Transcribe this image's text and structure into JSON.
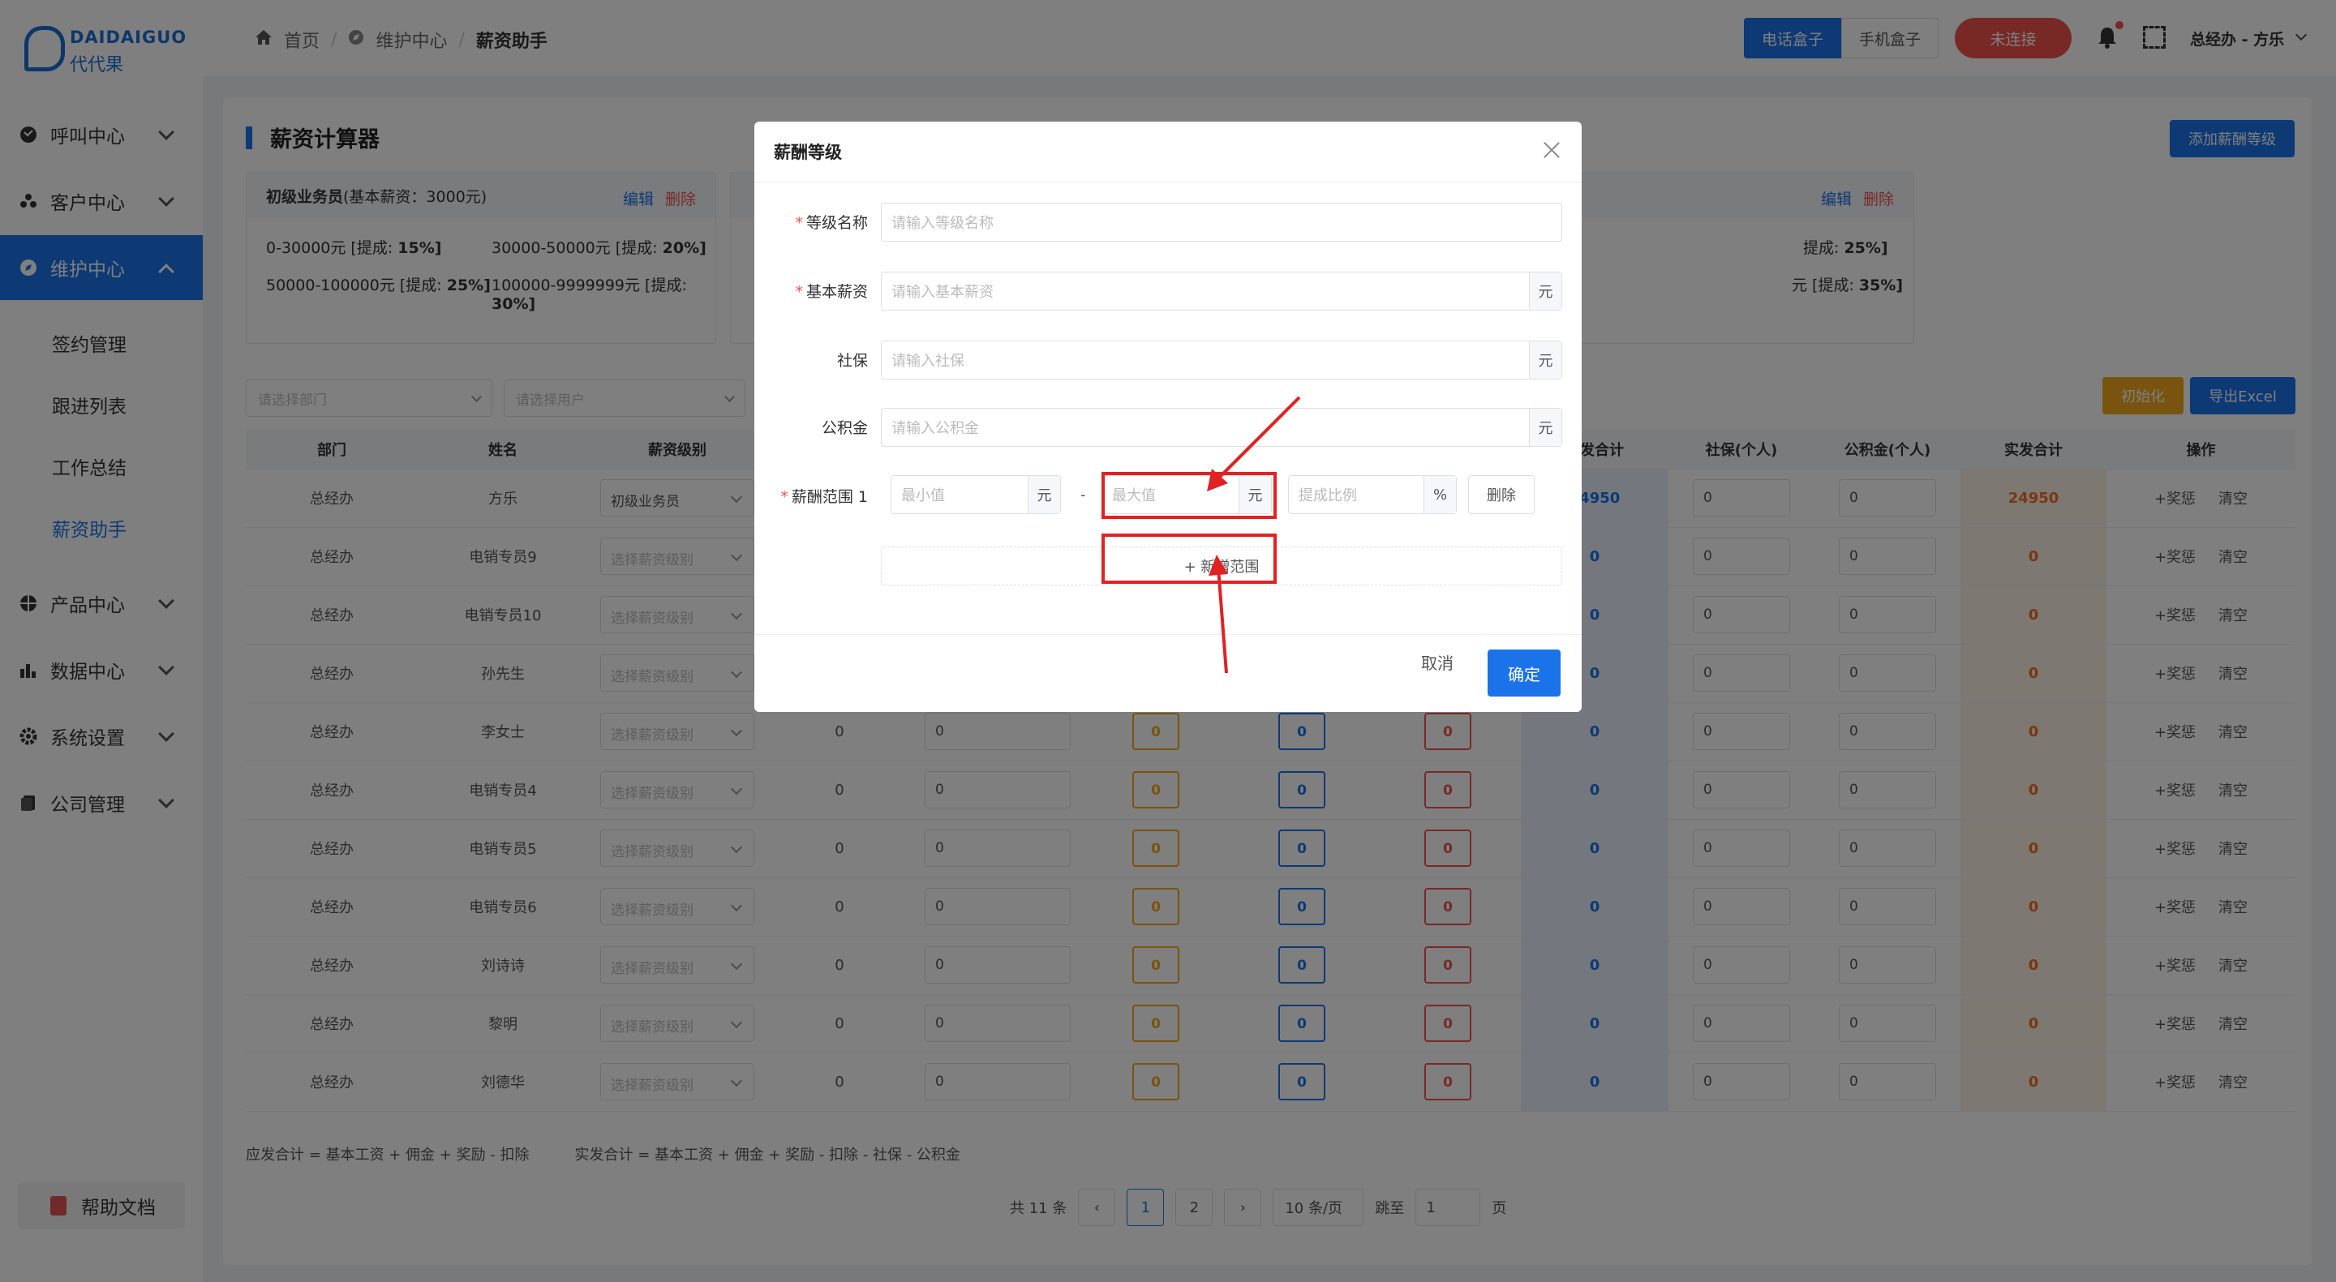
{
  "brand": {
    "name_en": "DAIDAIGUO",
    "name_cn": "代代果"
  },
  "sidebar": {
    "items": [
      {
        "label": "呼叫中心",
        "icon": "phone-icon"
      },
      {
        "label": "客户中心",
        "icon": "users-icon"
      },
      {
        "label": "维护中心",
        "icon": "compass-icon"
      },
      {
        "label": "产品中心",
        "icon": "box-icon"
      },
      {
        "label": "数据中心",
        "icon": "bar-chart-icon"
      },
      {
        "label": "系统设置",
        "icon": "gear-icon"
      },
      {
        "label": "公司管理",
        "icon": "file-icon"
      }
    ],
    "subitems": [
      "签约管理",
      "跟进列表",
      "工作总结",
      "薪资助手"
    ],
    "help": "帮助文档"
  },
  "header": {
    "breadcrumb": [
      "首页",
      "维护中心",
      "薪资助手"
    ],
    "phone_box": "电话盒子",
    "mobile_box": "手机盒子",
    "connection": "未连接",
    "user": "总经办 - 方乐"
  },
  "page": {
    "title": "薪资计算器",
    "add_level": "添加薪酬等级",
    "init": "初始化",
    "export": "导出Excel",
    "level_card": {
      "name": "初级业务员",
      "base": "(基本薪资：3000元)",
      "edit": "编辑",
      "delete": "删除",
      "ranges": [
        {
          "text": "0-30000元 [提成: ",
          "rate": "15%]"
        },
        {
          "text": "30000-50000元 [提成: ",
          "rate": "20%]"
        },
        {
          "text": "50000-100000元 [提成: ",
          "rate": "25%]"
        },
        {
          "text": "100000-9999999元 [提成: ",
          "rate": "30%]"
        }
      ]
    },
    "level_card2": {
      "edit": "编辑",
      "delete": "删除",
      "ranges": [
        {
          "text": "提成: ",
          "rate": "25%]"
        },
        {
          "text": "元 [提成: ",
          "rate": "35%]"
        }
      ]
    },
    "filters": {
      "dept": "请选择部门",
      "user": "请选择用户"
    },
    "columns": [
      "部门",
      "姓名",
      "薪资级别",
      "",
      "",
      "",
      "",
      "",
      "应发合计",
      "社保(个人)",
      "公积金(个人)",
      "实发合计",
      "操作"
    ],
    "rows": [
      {
        "dept": "总经办",
        "name": "方乐",
        "level": "初级业务员",
        "filled": true,
        "base": "",
        "sales": "",
        "due": "24950",
        "social": "0",
        "fund": "0",
        "net": "24950"
      },
      {
        "dept": "总经办",
        "name": "电销专员9",
        "level": "选择薪资级别",
        "filled": false,
        "base": "",
        "sales": "",
        "due": "0",
        "social": "0",
        "fund": "0",
        "net": "0"
      },
      {
        "dept": "总经办",
        "name": "电销专员10",
        "level": "选择薪资级别",
        "filled": false,
        "base": "",
        "sales": "",
        "due": "0",
        "social": "0",
        "fund": "0",
        "net": "0"
      },
      {
        "dept": "总经办",
        "name": "孙先生",
        "level": "选择薪资级别",
        "filled": false,
        "base": "",
        "sales": "",
        "due": "0",
        "social": "0",
        "fund": "0",
        "net": "0"
      },
      {
        "dept": "总经办",
        "name": "李女士",
        "level": "选择薪资级别",
        "filled": false,
        "base": "0",
        "sales": "0",
        "due": "0",
        "social": "0",
        "fund": "0",
        "net": "0"
      },
      {
        "dept": "总经办",
        "name": "电销专员4",
        "level": "选择薪资级别",
        "filled": false,
        "base": "0",
        "sales": "0",
        "due": "0",
        "social": "0",
        "fund": "0",
        "net": "0"
      },
      {
        "dept": "总经办",
        "name": "电销专员5",
        "level": "选择薪资级别",
        "filled": false,
        "base": "0",
        "sales": "0",
        "due": "0",
        "social": "0",
        "fund": "0",
        "net": "0"
      },
      {
        "dept": "总经办",
        "name": "电销专员6",
        "level": "选择薪资级别",
        "filled": false,
        "base": "0",
        "sales": "0",
        "due": "0",
        "social": "0",
        "fund": "0",
        "net": "0"
      },
      {
        "dept": "总经办",
        "name": "刘诗诗",
        "level": "选择薪资级别",
        "filled": false,
        "base": "0",
        "sales": "0",
        "due": "0",
        "social": "0",
        "fund": "0",
        "net": "0"
      },
      {
        "dept": "总经办",
        "name": "黎明",
        "level": "选择薪资级别",
        "filled": false,
        "base": "0",
        "sales": "0",
        "due": "0",
        "social": "0",
        "fund": "0",
        "net": "0"
      },
      {
        "dept": "总经办",
        "name": "刘德华",
        "level": "选择薪资级别",
        "filled": false,
        "base": "0",
        "sales": "0",
        "due": "0",
        "social": "0",
        "fund": "0",
        "net": "0"
      }
    ],
    "chip_values": {
      "bonus": "0",
      "commission": "0",
      "deduct": "0"
    },
    "row_actions": {
      "bonus": "+奖惩",
      "clear": "清空"
    },
    "formula1": "应发合计 = 基本工资 + 佣金 + 奖励 - 扣除",
    "formula2": "实发合计 = 基本工资 + 佣金 + 奖励 - 扣除 - 社保 - 公积金",
    "pagination": {
      "total": "共 11 条",
      "pages": [
        "1",
        "2"
      ],
      "size": "10 条/页",
      "jump_label": "跳至",
      "jump_value": "1",
      "page_unit": "页"
    }
  },
  "modal": {
    "title": "薪酬等级",
    "fields": [
      {
        "label": "等级名称",
        "required": true,
        "placeholder": "请输入等级名称",
        "suffix": ""
      },
      {
        "label": "基本薪资",
        "required": true,
        "placeholder": "请输入基本薪资",
        "suffix": "元"
      },
      {
        "label": "社保",
        "required": false,
        "placeholder": "请输入社保",
        "suffix": "元"
      },
      {
        "label": "公积金",
        "required": false,
        "placeholder": "请输入公积金",
        "suffix": "元"
      }
    ],
    "range": {
      "label": "薪酬范围 1",
      "min_placeholder": "最小值",
      "max_placeholder": "最大值",
      "unit": "元",
      "dash": "-",
      "rate_placeholder": "提成比例",
      "rate_unit": "%",
      "delete": "删除"
    },
    "add_range": "+  新增范围",
    "cancel": "取消",
    "confirm": "确定"
  },
  "colors": {
    "primary": "#1a73e8",
    "danger": "#f0524d",
    "warning": "#f0a81c",
    "annotation": "#e02222"
  }
}
